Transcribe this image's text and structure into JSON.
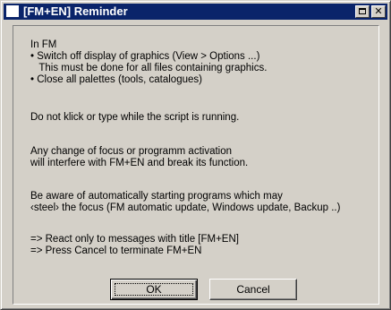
{
  "window": {
    "title": "[FM+EN] Reminder",
    "restore_button": "restore-icon",
    "close_button": "close-icon"
  },
  "message": {
    "block1": "In FM\n• Switch off display of graphics (View > Options ...)\n   This must be done for all files containing graphics.\n• Close all palettes (tools, catalogues)",
    "block2": "Do not klick or type while the script is running.",
    "block3": "Any change of focus or programm activation\nwill interfere with FM+EN and break its function.",
    "block4": "Be aware of automatically starting programs which may\n‹steel› the focus (FM automatic update, Windows update, Backup ..)",
    "block5": "=> React only to messages with title [FM+EN]\n=> Press Cancel to terminate FM+EN"
  },
  "buttons": {
    "ok_label": "OK",
    "cancel_label": "Cancel"
  },
  "colors": {
    "titlebar": "#0a246a",
    "face": "#d4d0c8"
  }
}
